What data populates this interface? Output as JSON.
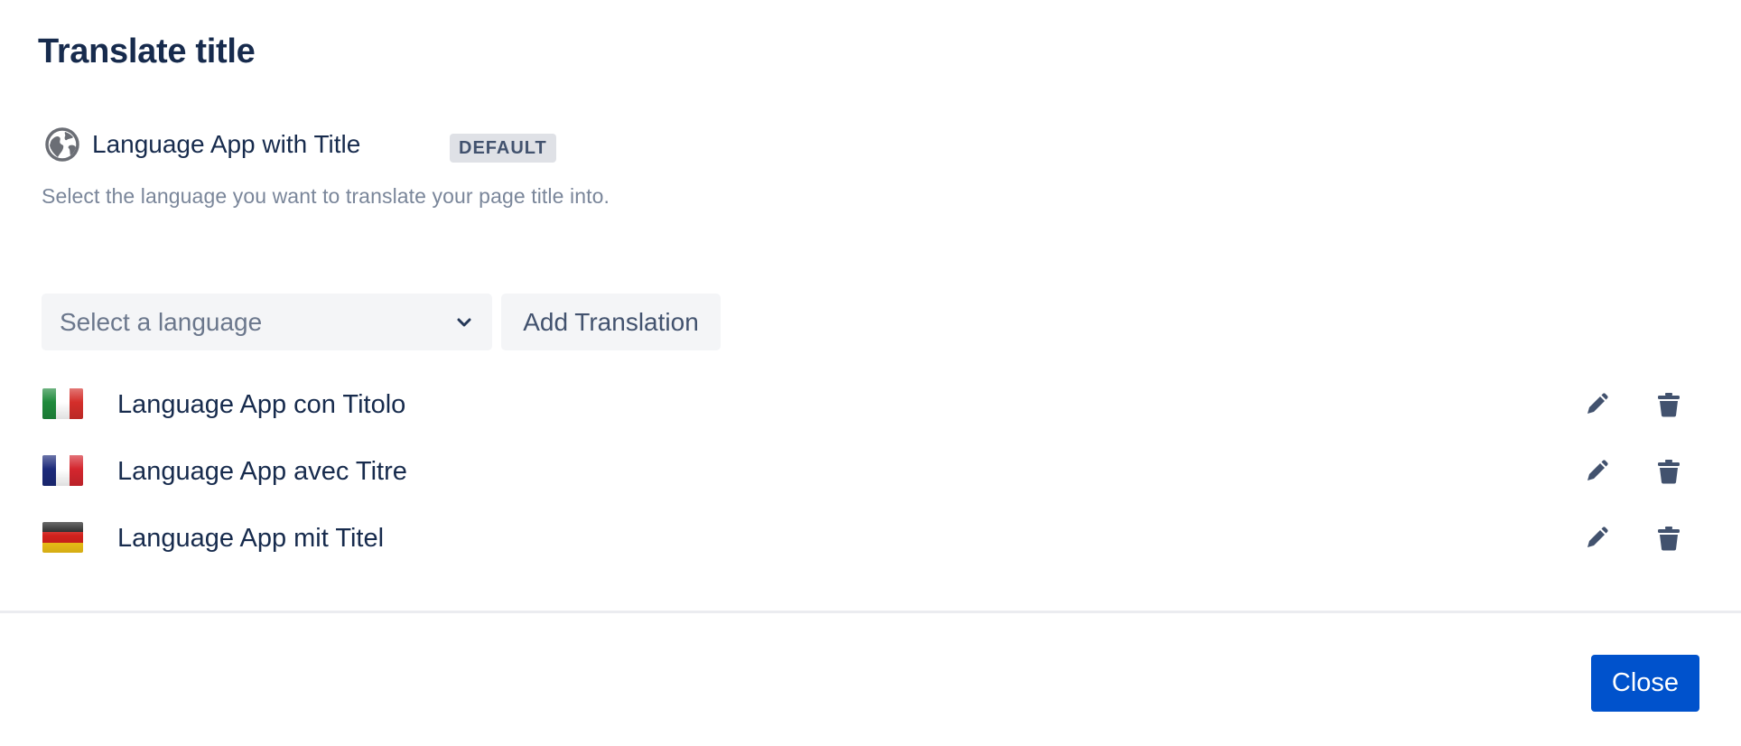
{
  "dialog": {
    "title": "Translate title",
    "default": {
      "icon": "globe-icon",
      "name": "Language App with Title",
      "badge": "DEFAULT"
    },
    "helper_text": "Select the language you want to translate your page title into."
  },
  "language_select": {
    "placeholder": "Select a language",
    "icon": "chevron-down-icon"
  },
  "add_button_label": "Add Translation",
  "translations": [
    {
      "flag": "italy-flag-icon",
      "flag_colors": [
        "#1f8a3c",
        "#ffffff",
        "#d42e2a"
      ],
      "label": "Language App con Titolo"
    },
    {
      "flag": "france-flag-icon",
      "flag_colors": [
        "#1c2a7a",
        "#ffffff",
        "#d4262e"
      ],
      "label": "Language App avec Titre"
    },
    {
      "flag": "germany-flag-icon",
      "flag_colors": [
        "#1a1a1a",
        "#d0211c",
        "#f2c417"
      ],
      "label": "Language App mit Titel"
    }
  ],
  "row_actions": {
    "edit_icon": "pencil-icon",
    "delete_icon": "trash-icon"
  },
  "footer": {
    "close_label": "Close"
  },
  "colors": {
    "primary": "#0052cc",
    "text": "#172b4d",
    "subtle_text": "#7a869a",
    "icon": "#42526e",
    "field_background": "#f4f5f7",
    "badge_background": "#dfe1e6"
  }
}
